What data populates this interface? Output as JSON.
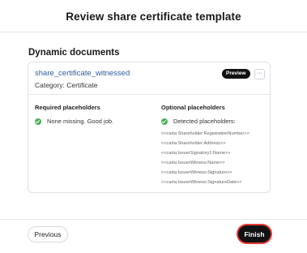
{
  "header": {
    "title": "Review share certificate template"
  },
  "section": {
    "title": "Dynamic documents"
  },
  "document": {
    "name": "share_certificate_witnessed",
    "category": "Category: Certificate",
    "preview_label": "Preview",
    "more_label": "···"
  },
  "required": {
    "title": "Required placeholders",
    "status": "None missing. Good job."
  },
  "optional": {
    "title": "Optional placeholders",
    "status": "Detected placeholders:",
    "items": [
      "<<carta:Shareholder:RegistrationNumber>>",
      "<<carta:Shareholder:Address>>",
      "<<carta:IssuerSignatory1:Name>>",
      "<<carta:IssuerWitness:Name>>",
      "<<carta:IssuerWitness:Signature>>",
      "<<carta:IssuerWitness:SignatureDate>>"
    ]
  },
  "footer": {
    "previous_label": "Previous",
    "finish_label": "Finish"
  },
  "colors": {
    "check": "#4caf50",
    "link": "#2f5d9c",
    "focus_ring": "#e53935",
    "primary_button": "#111111"
  },
  "icons": {
    "status": "check-circle-icon",
    "more": "ellipsis-icon"
  }
}
